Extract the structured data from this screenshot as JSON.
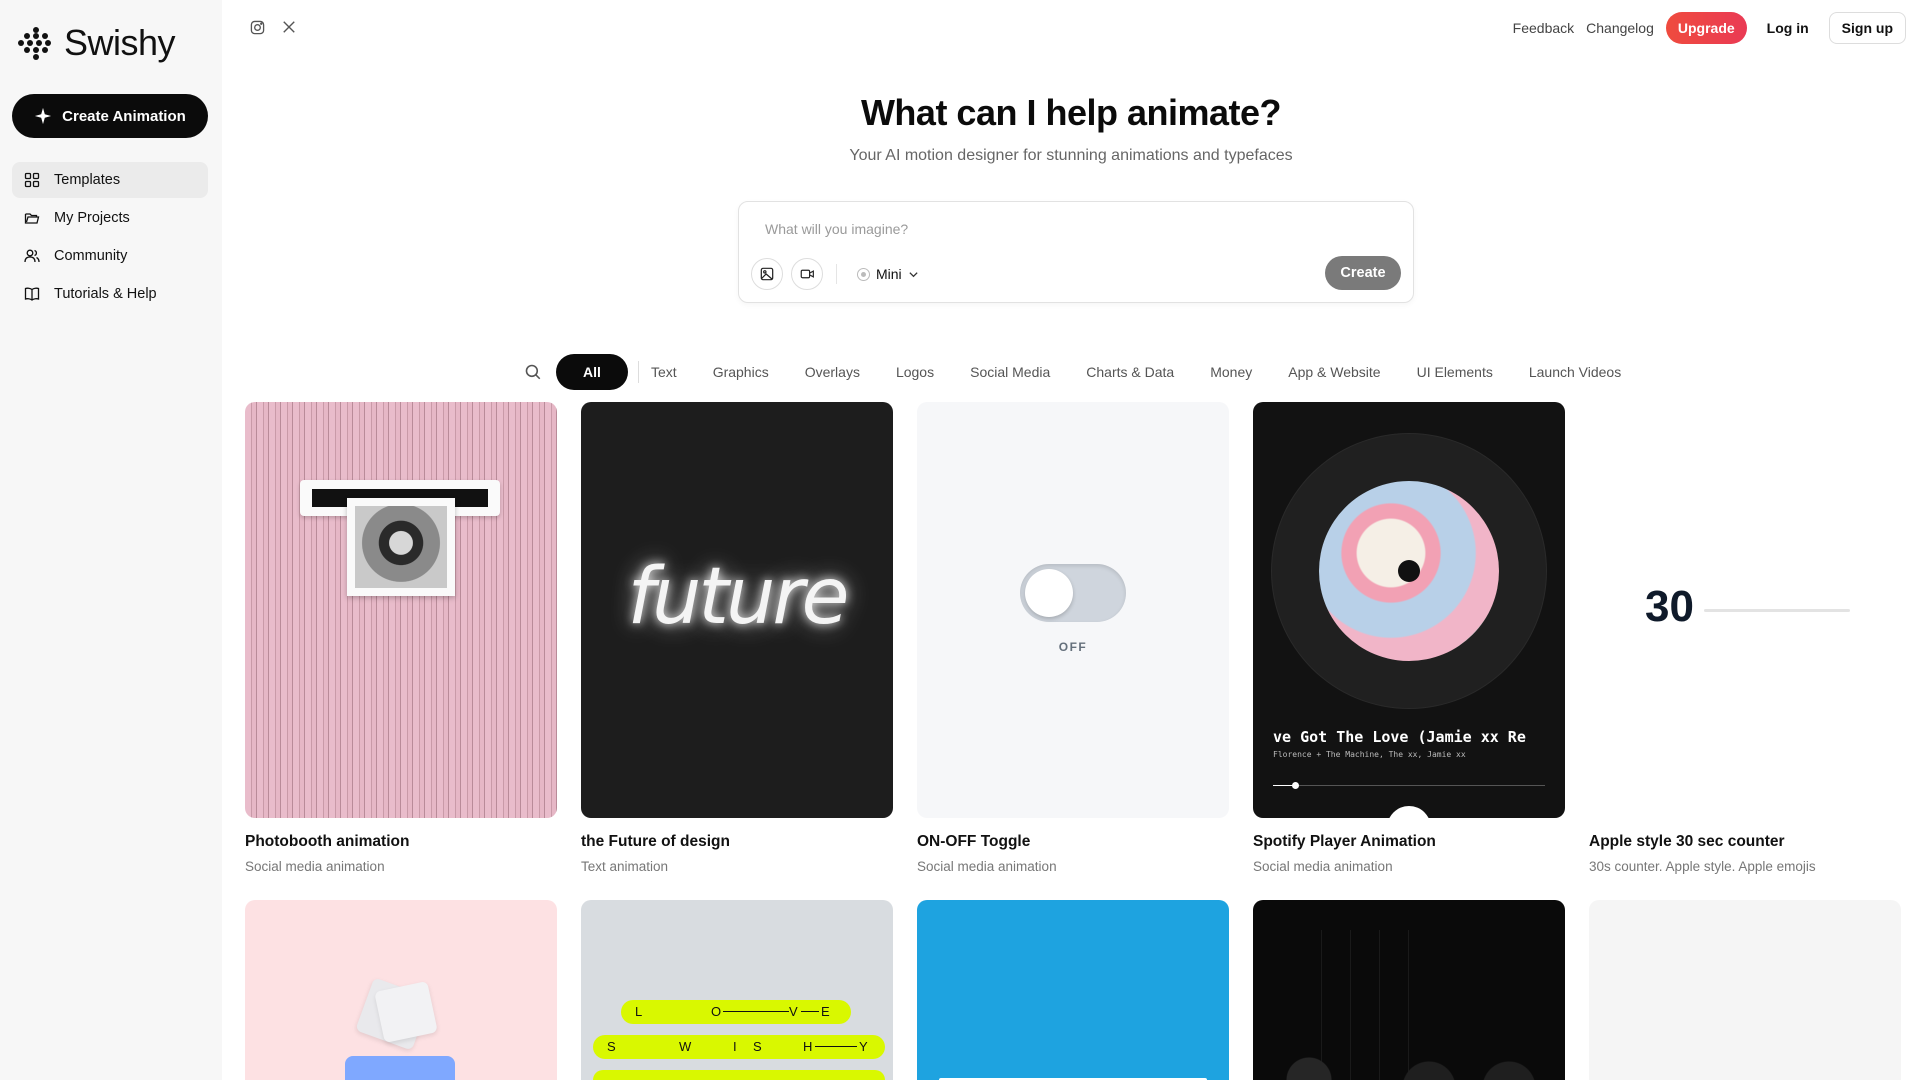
{
  "app": {
    "name": "Swishy"
  },
  "sidebar": {
    "create_label": "Create Animation",
    "items": [
      {
        "label": "Templates",
        "icon": "grid-icon",
        "active": true
      },
      {
        "label": "My Projects",
        "icon": "folder-icon"
      },
      {
        "label": "Community",
        "icon": "users-icon"
      },
      {
        "label": "Tutorials & Help",
        "icon": "book-icon"
      }
    ]
  },
  "topbar": {
    "social": [
      "instagram-icon",
      "x-icon"
    ],
    "feedback": "Feedback",
    "changelog": "Changelog",
    "upgrade": "Upgrade",
    "login": "Log in",
    "signup": "Sign up"
  },
  "hero": {
    "title": "What can I help animate?",
    "subtitle": "Your AI motion designer for stunning animations and typefaces"
  },
  "prompt": {
    "placeholder": "What will you imagine?",
    "model": "Mini",
    "create_label": "Create"
  },
  "filters": {
    "active": "All",
    "items": [
      "Text",
      "Graphics",
      "Overlays",
      "Logos",
      "Social Media",
      "Charts & Data",
      "Money",
      "App & Website",
      "UI Elements",
      "Launch Videos"
    ]
  },
  "cards": [
    {
      "title": "Photobooth animation",
      "subtitle": "Social media animation"
    },
    {
      "title": "the Future of design",
      "subtitle": "Text animation",
      "preview_text": "future"
    },
    {
      "title": "ON-OFF Toggle",
      "subtitle": "Social media animation",
      "preview_text": "OFF"
    },
    {
      "title": "Spotify Player Animation",
      "subtitle": "Social media animation",
      "song": "ve Got The Love (Jamie xx Re",
      "artist": "Florence + The Machine, The xx, Jamie xx"
    },
    {
      "title": "Apple style 30 sec counter",
      "subtitle": "30s counter. Apple style. Apple emojis",
      "preview_text": "30"
    }
  ],
  "row2": [
    {
      "label": "folder-preview"
    },
    {
      "words": [
        "L",
        "O",
        "V",
        "E",
        "S",
        "W",
        "I",
        "S",
        "H",
        "Y"
      ]
    },
    {
      "label": "blue-preview"
    },
    {
      "label": "dark-preview"
    },
    {
      "label": "light-preview"
    }
  ],
  "colors": {
    "accent": "#ef4b3e",
    "dark": "#0b0b0b",
    "lime": "#d9f800",
    "pink": "#e5b9c6",
    "blue": "#1ea3e0"
  }
}
